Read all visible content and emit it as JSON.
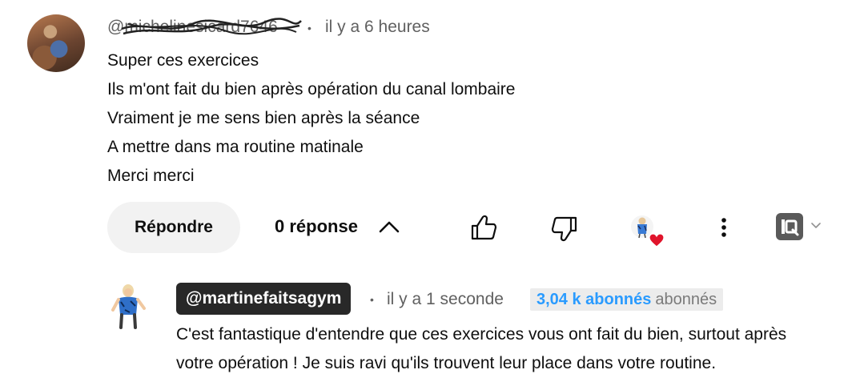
{
  "comment": {
    "author_handle": "@michelinesicard7646",
    "time": "il y a 6 heures",
    "lines": [
      "Super ces exercices",
      "Ils m'ont fait du bien après opération du canal lombaire",
      "Vraiment je me sens bien après la séance",
      "A mettre dans ma routine matinale",
      "Merci merci"
    ]
  },
  "actions": {
    "reply_label": "Répondre",
    "reply_count": "0 réponse"
  },
  "reply": {
    "author_handle": "@martinefaitsagym",
    "time": "il y a 1 seconde",
    "subscribers_count": "3,04 k abonnés",
    "subscribers_label": "abonnés",
    "lines": [
      "C'est fantastique d'entendre que ces exercices vous ont fait du bien, surtout après",
      "votre opération ! Je suis ravi qu'ils trouvent leur place dans votre routine."
    ]
  },
  "colors": {
    "accent_blue": "#2a9bff",
    "heart_red": "#e0142b",
    "handle_badge_bg": "#282828"
  },
  "icons": {
    "like": "thumbs-up-icon",
    "dislike": "thumbs-down-icon",
    "more": "more-vert-icon",
    "collapse": "chevron-up-icon",
    "extension": "extension-icon"
  }
}
